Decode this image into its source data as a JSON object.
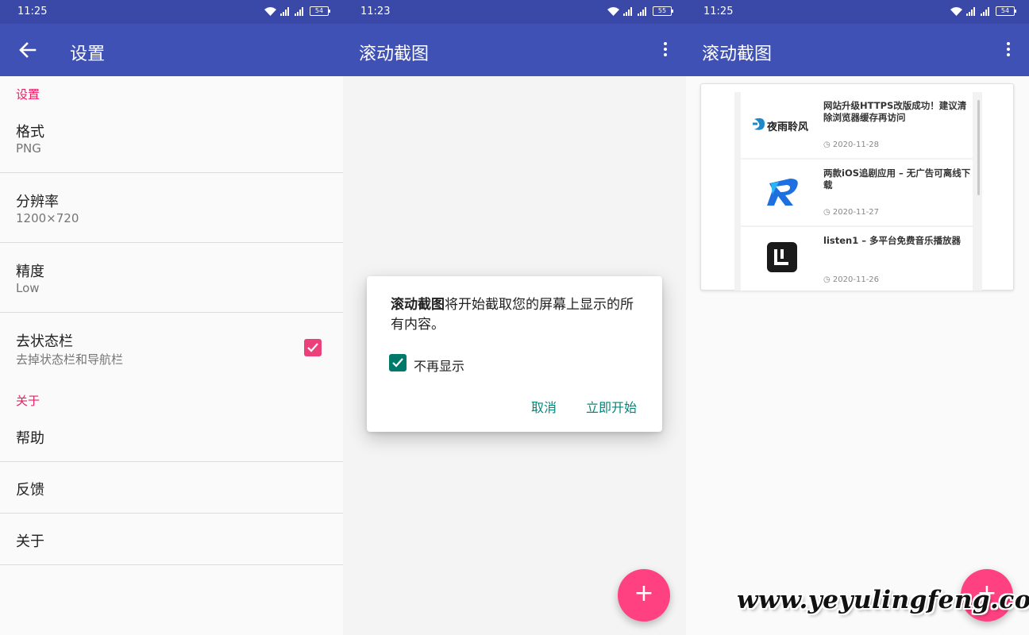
{
  "panel1": {
    "status": {
      "time": "11:25",
      "battery": "54",
      "net1": "4G",
      "net2": "2G"
    },
    "appbar": {
      "title": "设置"
    },
    "sections": [
      {
        "header": "设置"
      },
      {
        "header": "关于"
      }
    ],
    "items": {
      "format": {
        "title": "格式",
        "value": "PNG"
      },
      "resolution": {
        "title": "分辨率",
        "value": "1200×720"
      },
      "precision": {
        "title": "精度",
        "value": "Low"
      },
      "statusbar": {
        "title": "去状态栏",
        "value": "去掉状态栏和导航栏",
        "checked": true
      },
      "help": {
        "title": "帮助"
      },
      "feedback": {
        "title": "反馈"
      },
      "about": {
        "title": "关于"
      }
    }
  },
  "panel2": {
    "status": {
      "time": "11:23",
      "battery": "55",
      "net1": "4G",
      "net2": "2G"
    },
    "appbar": {
      "title": "滚动截图"
    },
    "dialog": {
      "message_bold": "滚动截图",
      "message_rest": "将开始截取您的屏幕上显示的所有内容。",
      "checkbox_label": "不再显示",
      "checkbox_checked": true,
      "cancel": "取消",
      "confirm": "立即开始"
    },
    "fab": "+"
  },
  "panel3": {
    "status": {
      "time": "11:25",
      "battery": "54",
      "net1": "4G",
      "net2": "2G"
    },
    "appbar": {
      "title": "滚动截图"
    },
    "articles": [
      {
        "title": "网站升级HTTPS改版成功！建议清除浏览器缓存再访问",
        "date": "2020-11-28",
        "logo": "夜雨聆风"
      },
      {
        "title": "两款iOS追剧应用 – 无广告可离线下载",
        "date": "2020-11-27",
        "logo": "R"
      },
      {
        "title": "listen1 – 多平台免费音乐播放器",
        "date": "2020-11-26",
        "logo": "L"
      }
    ],
    "fab": "+"
  },
  "watermark": "www.yeyulingfeng.com",
  "colors": {
    "statusbar": "#3a48a8",
    "appbar": "#3f51b5",
    "accent": "#e91e63",
    "fab": "#ff4081",
    "dialog_button": "#00897b"
  }
}
